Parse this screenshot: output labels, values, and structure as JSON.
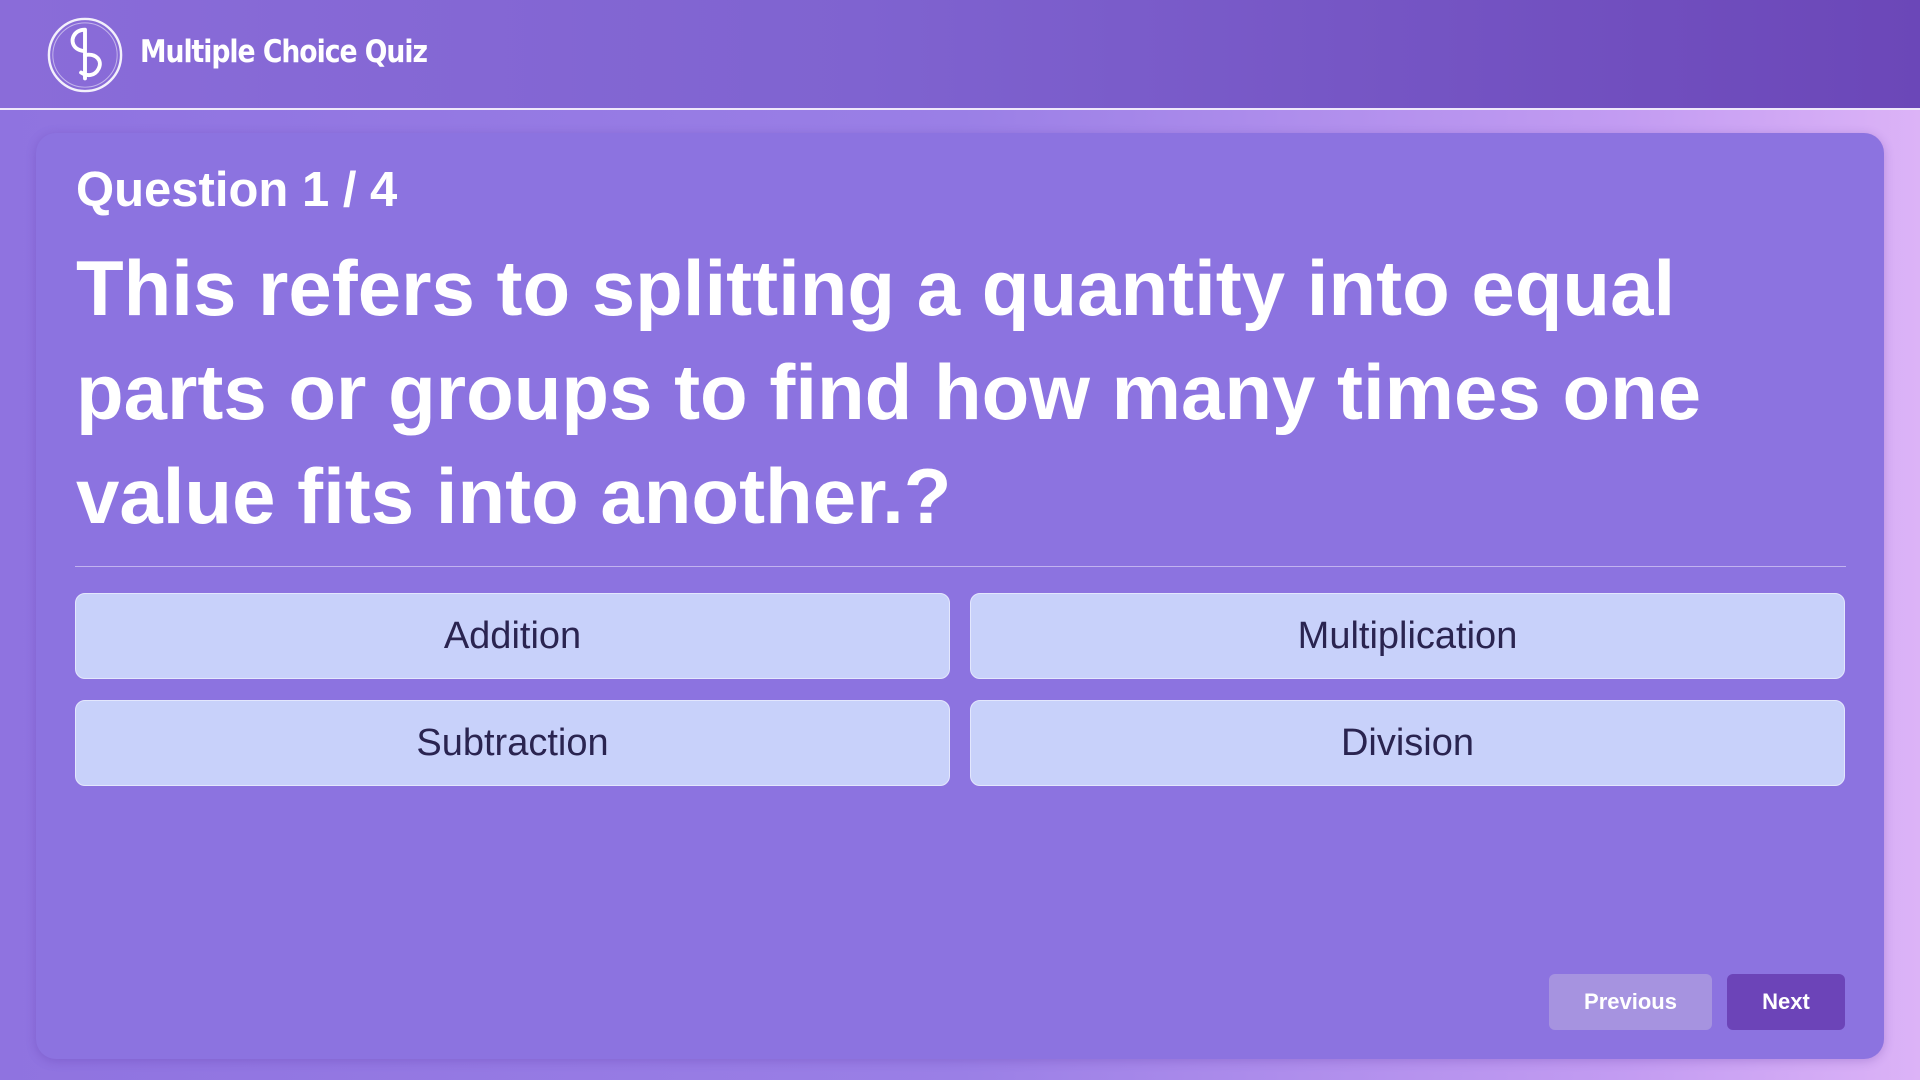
{
  "header": {
    "title": "Multiple Choice Quiz",
    "logo_icon": "yb-monogram-logo"
  },
  "quiz": {
    "counter": "Question 1 / 4",
    "question": "This refers to splitting a quantity into equal parts or groups to find how many times one value fits into another.?",
    "options": [
      {
        "label": "Addition"
      },
      {
        "label": "Multiplication"
      },
      {
        "label": "Subtraction"
      },
      {
        "label": "Division"
      }
    ]
  },
  "nav": {
    "previous_label": "Previous",
    "next_label": "Next"
  },
  "colors": {
    "header_start": "#8a6cd9",
    "header_end": "#6b47b8",
    "card": "#8c73e0",
    "option_bg": "#c8d1fa",
    "option_text": "#2a2450",
    "previous_button": "#a693e0",
    "next_button": "#6c44b8"
  }
}
